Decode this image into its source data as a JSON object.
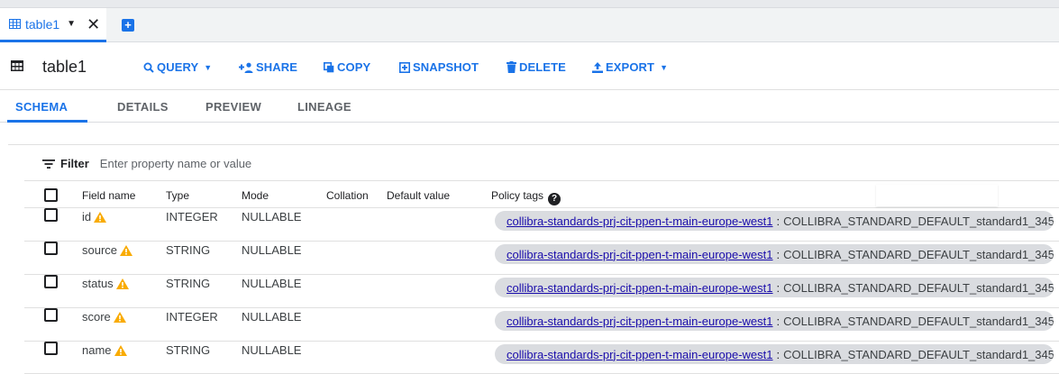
{
  "tab": {
    "label": "table1"
  },
  "header": {
    "title": "table1"
  },
  "toolbar": {
    "query": "QUERY",
    "share": "SHARE",
    "copy": "COPY",
    "snapshot": "SNAPSHOT",
    "delete": "DELETE",
    "export": "EXPORT"
  },
  "subtabs": [
    "SCHEMA",
    "DETAILS",
    "PREVIEW",
    "LINEAGE"
  ],
  "filter": {
    "label": "Filter",
    "placeholder": "Enter property name or value"
  },
  "columns": {
    "field_name": "Field name",
    "type": "Type",
    "mode": "Mode",
    "collation": "Collation",
    "default_value": "Default value",
    "policy_tags": "Policy tags"
  },
  "rows": [
    {
      "name": "id",
      "type": "INTEGER",
      "mode": "NULLABLE",
      "tag_project": "collibra-standards-prj-cit-ppen-t-main-europe-west1",
      "tag_sep": ":",
      "tag_name": "COLLIBRA_STANDARD_DEFAULT_standard1_345"
    },
    {
      "name": "source",
      "type": "STRING",
      "mode": "NULLABLE",
      "tag_project": "collibra-standards-prj-cit-ppen-t-main-europe-west1",
      "tag_sep": ":",
      "tag_name": "COLLIBRA_STANDARD_DEFAULT_standard1_345"
    },
    {
      "name": "status",
      "type": "STRING",
      "mode": "NULLABLE",
      "tag_project": "collibra-standards-prj-cit-ppen-t-main-europe-west1",
      "tag_sep": ":",
      "tag_name": "COLLIBRA_STANDARD_DEFAULT_standard1_345"
    },
    {
      "name": "score",
      "type": "INTEGER",
      "mode": "NULLABLE",
      "tag_project": "collibra-standards-prj-cit-ppen-t-main-europe-west1",
      "tag_sep": ":",
      "tag_name": "COLLIBRA_STANDARD_DEFAULT_standard1_345"
    },
    {
      "name": "name",
      "type": "STRING",
      "mode": "NULLABLE",
      "tag_project": "collibra-standards-prj-cit-ppen-t-main-europe-west1",
      "tag_sep": ":",
      "tag_name": "COLLIBRA_STANDARD_DEFAULT_standard1_345"
    }
  ],
  "icons": {
    "table": "table-icon",
    "add_tab": "add-tab-icon",
    "close": "close-icon",
    "search": "search-icon",
    "share": "person-add-icon",
    "copy": "copy-icon",
    "snapshot": "snapshot-icon",
    "delete": "trash-icon",
    "export": "upload-icon",
    "filter": "filter-icon",
    "warning": "warning-icon",
    "help": "help-icon"
  },
  "colors": {
    "accent": "#1a73e8",
    "warning": "#f9ab00",
    "chip": "#dadce0"
  }
}
